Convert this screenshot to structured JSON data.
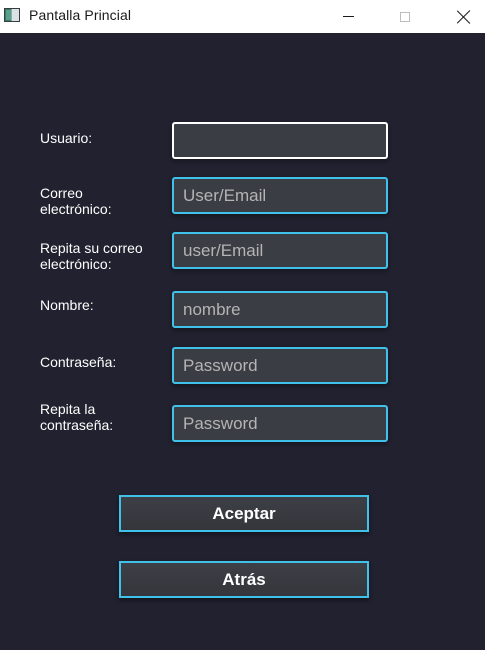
{
  "window": {
    "title": "Pantalla Princial",
    "controls": [
      "minimize-icon",
      "maximize-icon",
      "close-icon"
    ]
  },
  "form": {
    "usuario": {
      "label": "Usuario:",
      "value": "",
      "placeholder": "",
      "focused": true
    },
    "correo": {
      "label": "Correo\nelectrónico:",
      "value": "",
      "placeholder": "User/Email"
    },
    "correo_repeat": {
      "label": "Repita su correo\nelectrónico:",
      "value": "",
      "placeholder": "user/Email"
    },
    "nombre": {
      "label": "Nombre:",
      "value": "",
      "placeholder": "nombre"
    },
    "password": {
      "label": "Contraseña:",
      "value": "",
      "placeholder": "Password"
    },
    "password_repeat": {
      "label": "Repita la\ncontraseña:",
      "value": "",
      "placeholder": "Password"
    }
  },
  "buttons": {
    "accept": "Aceptar",
    "back": "Atrás"
  },
  "colors": {
    "background": "#21212f",
    "input_background": "#3b3d44",
    "accent_border": "#3fc1e9",
    "focused_border": "#ffffff",
    "text": "#ffffff",
    "placeholder": "#b4b4b4"
  }
}
